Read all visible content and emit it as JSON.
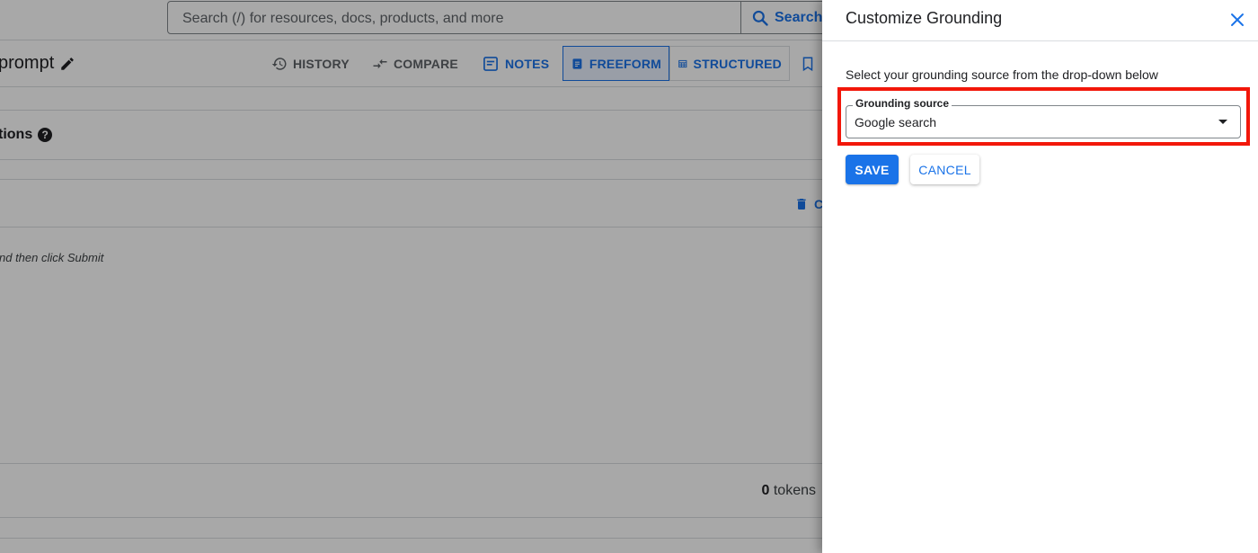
{
  "background": {
    "search": {
      "placeholder": "Search (/) for resources, docs, products, and more",
      "button_label": "Search"
    },
    "page_title": "prompt",
    "toolbar": {
      "history": "HISTORY",
      "compare": "COMPARE",
      "notes": "NOTES",
      "freeform": "FREEFORM",
      "structured": "STRUCTURED"
    },
    "section_label": "tions",
    "clear_label": "C",
    "hint_text": "nd then click Submit",
    "tokens_count": "0",
    "tokens_label": "tokens"
  },
  "panel": {
    "title": "Customize Grounding",
    "description": "Select your grounding source from the drop-down below",
    "grounding_field": {
      "label": "Grounding source",
      "value": "Google search"
    },
    "save_label": "SAVE",
    "cancel_label": "CANCEL"
  },
  "colors": {
    "accent": "#1a73e8",
    "highlight": "#f2170a"
  }
}
